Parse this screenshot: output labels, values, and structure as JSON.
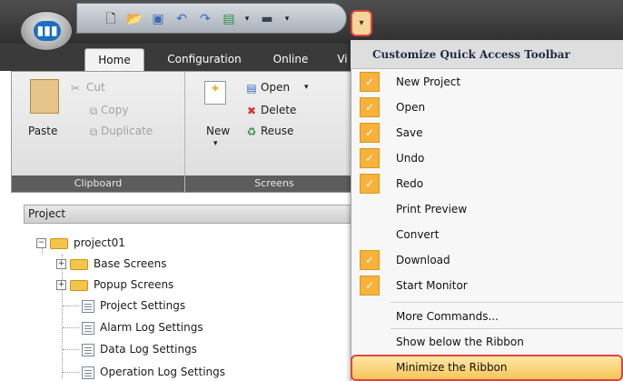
{
  "colors": {
    "accent_check": "#f6b23a",
    "highlight_border": "#e0453a",
    "titlebar_dark": "#3a3a3a"
  },
  "qat": {
    "icons": [
      "new-file-icon",
      "open-folder-icon",
      "save-icon",
      "undo-icon",
      "redo-icon",
      "screen-preview-icon",
      "monitor-icon"
    ],
    "customize_dropdown_icon": "chevron-down-icon"
  },
  "tabs": [
    {
      "label": "Home"
    },
    {
      "label": "Configuration"
    },
    {
      "label": "Online"
    },
    {
      "label": "Vi"
    }
  ],
  "ribbon": {
    "clipboard": {
      "paste": "Paste",
      "cut": "Cut",
      "copy": "Copy",
      "duplicate": "Duplicate",
      "group_label": "Clipboard"
    },
    "screens": {
      "new": "New",
      "open": "Open",
      "delete": "Delete",
      "reuse": "Reuse",
      "group_label": "Screens"
    }
  },
  "project_panel": {
    "header": "Project",
    "tree": [
      {
        "label": "project01",
        "icon": "folder-icon"
      },
      {
        "label": "Base Screens",
        "icon": "folder-icon"
      },
      {
        "label": "Popup Screens",
        "icon": "folder-icon"
      },
      {
        "label": "Project Settings",
        "icon": "settings-doc-icon"
      },
      {
        "label": "Alarm Log Settings",
        "icon": "settings-doc-icon"
      },
      {
        "label": "Data Log Settings",
        "icon": "settings-doc-icon"
      },
      {
        "label": "Operation Log Settings",
        "icon": "settings-doc-icon"
      }
    ]
  },
  "menu": {
    "title": "Customize Quick Access Toolbar",
    "items": [
      {
        "label": "New Project",
        "checked": true
      },
      {
        "label": "Open",
        "checked": true
      },
      {
        "label": "Save",
        "checked": true
      },
      {
        "label": "Undo",
        "checked": true
      },
      {
        "label": "Redo",
        "checked": true
      },
      {
        "label": "Print Preview",
        "checked": false
      },
      {
        "label": "Convert",
        "checked": false
      },
      {
        "label": "Download",
        "checked": true
      },
      {
        "label": "Start Monitor",
        "checked": true
      }
    ],
    "more_commands": "More Commands...",
    "show_below": "Show below the Ribbon",
    "minimize": "Minimize the Ribbon"
  }
}
